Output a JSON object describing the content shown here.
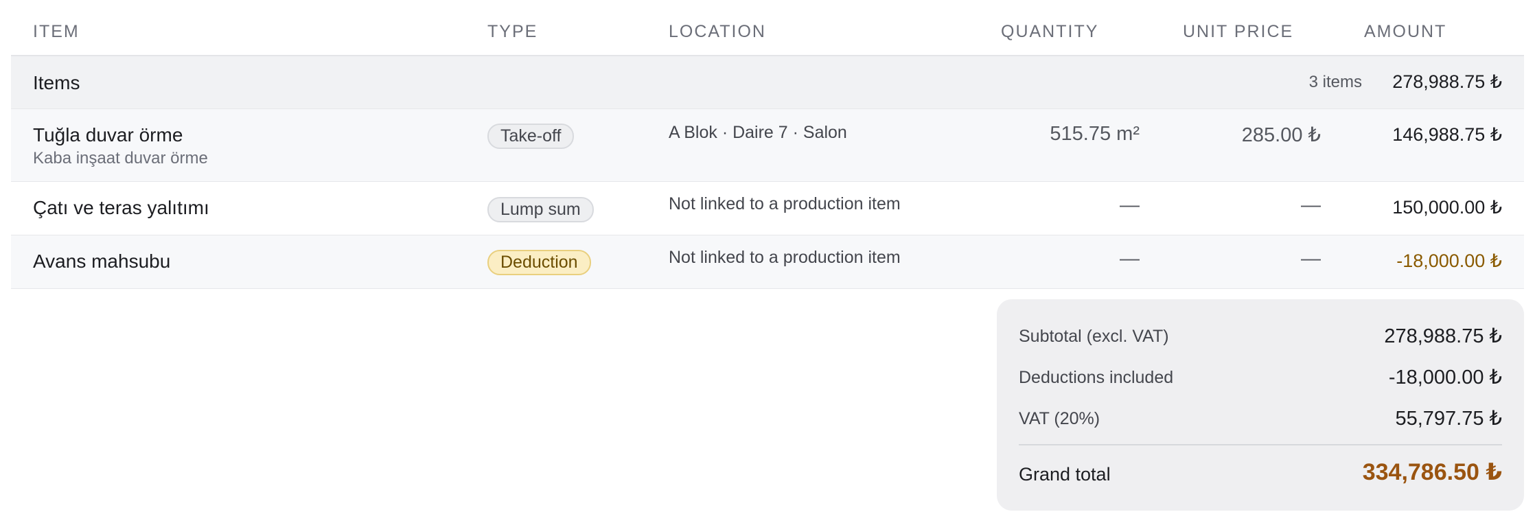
{
  "columns": {
    "item": "ITEM",
    "type": "TYPE",
    "location": "LOCATION",
    "quantity": "QUANTITY",
    "unit_price": "UNIT PRICE",
    "amount": "AMOUNT"
  },
  "group": {
    "label": "Items",
    "count": "3 items",
    "amount": "278,988.75 ₺"
  },
  "rows": [
    {
      "name": "Tuğla duvar örme",
      "subtitle": "Kaba inşaat duvar örme",
      "type": "Take-off",
      "location": "A Blok · Daire 7 · Salon",
      "quantity": "515.75 m²",
      "unit_price": "285.00 ₺",
      "amount": "146,988.75 ₺"
    },
    {
      "name": "Çatı ve teras yalıtımı",
      "type": "Lump sum",
      "location": "Not linked to a production item",
      "quantity": "—",
      "unit_price": "—",
      "amount": "150,000.00 ₺"
    },
    {
      "name": "Avans mahsubu",
      "type": "Deduction",
      "location": "Not linked to a production item",
      "quantity": "—",
      "unit_price": "—",
      "amount": "-18,000.00 ₺"
    }
  ],
  "totals": {
    "subtotal_label": "Subtotal (excl. VAT)",
    "subtotal_value": "278,988.75 ₺",
    "deductions_label": "Deductions included",
    "deductions_value": "-18,000.00 ₺",
    "vat_label": "VAT (20%)",
    "vat_value": "55,797.75 ₺",
    "grand_label": "Grand total",
    "grand_value": "334,786.50 ₺"
  },
  "colors": {
    "deduction_badge_bg": "#fbeec4",
    "deduction_amount": "#8a5a00",
    "grand_total": "#9a5410"
  }
}
